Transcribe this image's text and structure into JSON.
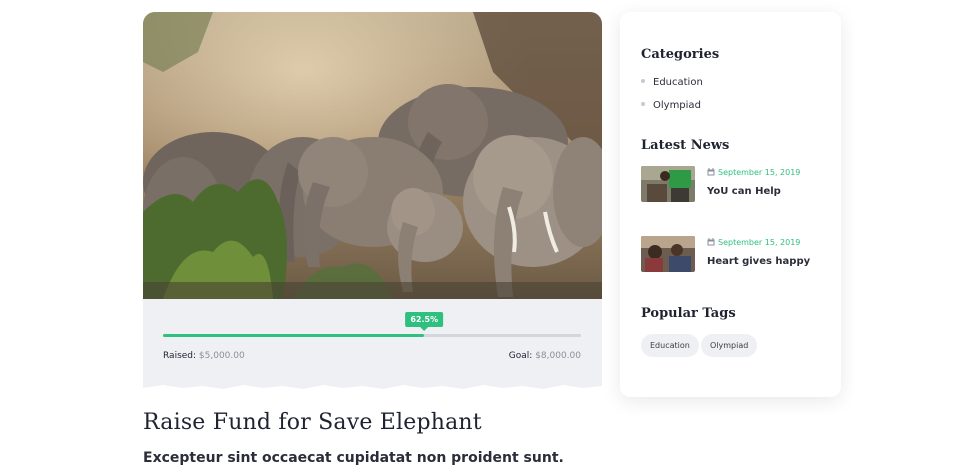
{
  "campaign": {
    "progress": {
      "percent_label": "62.5%",
      "fraction": 0.625,
      "raised_label": "Raised:",
      "raised_value": "$5,000.00",
      "goal_label": "Goal:",
      "goal_value": "$8,000.00"
    },
    "title": "Raise Fund for Save Elephant",
    "subtitle": "Excepteur sint occaecat cupidatat non proident sunt."
  },
  "sidebar": {
    "categories_heading": "Categories",
    "categories": [
      "Education",
      "Olympiad"
    ],
    "news_heading": "Latest News",
    "news": [
      {
        "date": "September 15, 2019",
        "title": "YoU can Help"
      },
      {
        "date": "September 15, 2019",
        "title": "Heart gives happy"
      }
    ],
    "tags_heading": "Popular Tags",
    "tags": [
      "Education",
      "Olympiad"
    ]
  },
  "colors": {
    "accent": "#2fbf7f",
    "panel": "#eef0f4",
    "text": "#1f2230"
  }
}
